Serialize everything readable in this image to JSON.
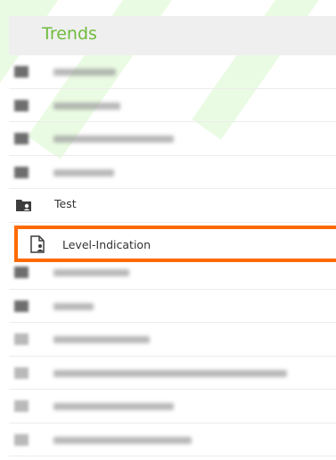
{
  "header": {
    "title": "Trends"
  },
  "items": [
    {
      "kind": "blurred"
    },
    {
      "kind": "blurred"
    },
    {
      "kind": "blurred"
    },
    {
      "kind": "blurred"
    },
    {
      "kind": "folder",
      "label": "Test"
    },
    {
      "kind": "document",
      "label": "Level-Indication",
      "selected": true
    },
    {
      "kind": "blurred"
    },
    {
      "kind": "blurred"
    },
    {
      "kind": "blurred"
    },
    {
      "kind": "blurred"
    },
    {
      "kind": "blurred"
    },
    {
      "kind": "blurred"
    }
  ],
  "colors": {
    "accent": "#6fbb3c",
    "highlight_border": "#ff6a00",
    "header_bg": "#efefef"
  },
  "icons": {
    "folder": "folder-user-icon",
    "document": "document-user-icon"
  }
}
